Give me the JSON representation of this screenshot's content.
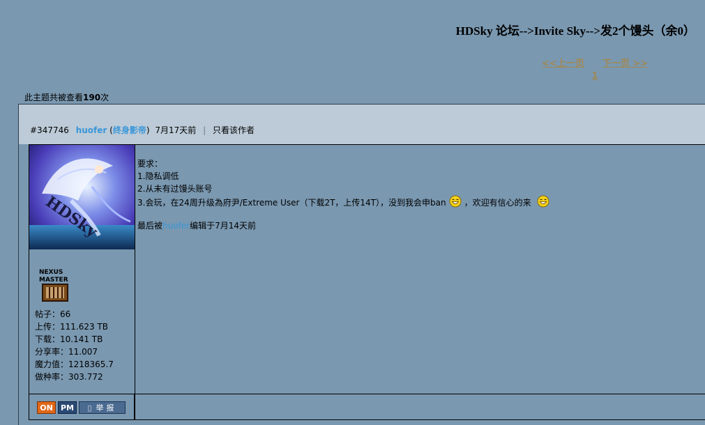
{
  "header": {
    "title": "HDSky 论坛-->Invite Sky-->发2个馒头（余0）"
  },
  "pager": {
    "prev": "<<上一页",
    "next": "下一页 >>",
    "page": "1"
  },
  "view_count": {
    "prefix": "此主题共被查看",
    "count": "190",
    "suffix": "次"
  },
  "post": {
    "id": "#347746",
    "username": "huofer",
    "rank_open": "(",
    "rank": "终身影帝",
    "rank_close": ")",
    "time": "7月17天前",
    "separator": "|",
    "only_author": "只看该作者",
    "body": {
      "line1": "要求：",
      "line2": "1.隐私调低",
      "line3": "2.从未有过馒头账号",
      "line4a": "3.会玩，在24周升级為府尹/Extreme User（下载2T，上传14T），没到我会申ban",
      "line4b": "，欢迎有信心的来"
    },
    "edited_prefix": "最后被",
    "edited_by": "huofer",
    "edited_suffix": "编辑于7月14天前"
  },
  "user": {
    "avatar_text": "HDSky",
    "class_badge": "NEXUS MASTER",
    "stats": {
      "posts": "帖子：66",
      "uploaded": "上传：111.623 TB",
      "downloaded": "下载：10.141 TB",
      "ratio": "分享率：11.007",
      "bonus": "魔力值：1218365.7",
      "seed_rate": "做种率：303.772"
    }
  },
  "actions": {
    "online": "ON",
    "pm": "PM",
    "report": "举报"
  },
  "icons": {
    "smiley": "smiley-icon",
    "report": "report-icon"
  }
}
